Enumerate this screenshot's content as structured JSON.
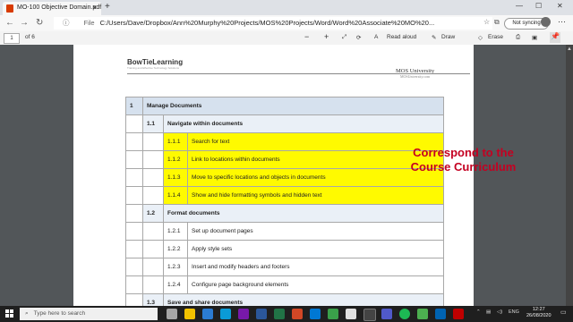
{
  "browser": {
    "tab_title": "MO-100 Objective Domain.pdf",
    "new_tab": "+",
    "address_label": "File",
    "url": "C:/Users/Dave/Dropbox/Ann%20Murphy%20Projects/MOS%20Projects/Word/Word%20Associate%20MO%20...",
    "sync_label": "Not syncing"
  },
  "pdf_toolbar": {
    "page_number": "1",
    "page_count": "of 6",
    "zoom_out": "−",
    "zoom_in": "+",
    "read_aloud": "Read aloud",
    "draw": "Draw",
    "erase": "Erase"
  },
  "document": {
    "brand": "BowTieLearning",
    "brand_tag": "Training and Effective Technology Solutions",
    "mos": "MOS University",
    "mos_sub": "MOSUniversity.com",
    "rows": [
      {
        "type": "section",
        "num": "1",
        "label": "Manage Documents"
      },
      {
        "type": "sub",
        "num": "1.1",
        "label": "Navigate within documents"
      },
      {
        "type": "item",
        "num": "1.1.1",
        "label": "Search for text",
        "hl": true
      },
      {
        "type": "item",
        "num": "1.1.2",
        "label": "Link to locations within documents",
        "hl": true
      },
      {
        "type": "item",
        "num": "1.1.3",
        "label": "Move to specific locations and objects in documents",
        "hl": true
      },
      {
        "type": "item",
        "num": "1.1.4",
        "label": "Show and hide formatting symbols and hidden text",
        "hl": true
      },
      {
        "type": "sub",
        "num": "1.2",
        "label": "Format documents"
      },
      {
        "type": "item",
        "num": "1.2.1",
        "label": "Set up document pages",
        "hl": false
      },
      {
        "type": "item",
        "num": "1.2.2",
        "label": "Apply style sets",
        "hl": false
      },
      {
        "type": "item",
        "num": "1.2.3",
        "label": "Insert and modify headers and footers",
        "hl": false
      },
      {
        "type": "item",
        "num": "1.2.4",
        "label": "Configure page background elements",
        "hl": false
      },
      {
        "type": "sub",
        "num": "1.3",
        "label": "Save and share documents"
      }
    ]
  },
  "overlay": {
    "line1": "Correspond to the",
    "line2": "Course Curriculum"
  },
  "taskbar": {
    "search_placeholder": "Type here to search",
    "lang": "ENG",
    "time": "12:27",
    "date": "26/08/2020"
  },
  "colors": {
    "highlight": "#fffa00",
    "overlay_text": "#c40021",
    "header_fill": "#d6e1ee"
  }
}
